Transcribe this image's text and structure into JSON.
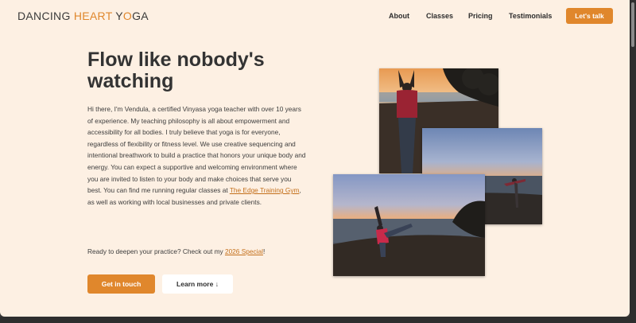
{
  "brand": {
    "part1": "DANCING ",
    "part2": "HEART",
    "part3": " Y",
    "part4": "O",
    "part5": "GA"
  },
  "nav": {
    "links": [
      "About",
      "Classes",
      "Pricing",
      "Testimonials"
    ],
    "cta_label": "Let's talk"
  },
  "hero": {
    "headline": "Flow like nobody's watching",
    "bio_before_link": "Hi there, I'm Vendula, a certified Vinyasa yoga teacher with over 10 years of experience. My teaching philosophy is all about empowerment and accessibility for all bodies. I truly believe that yoga is for everyone, regardless of flexibility or fitness level. We use creative sequencing and intentional breathwork to build a practice that honors your unique body and energy. You can expect a supportive and welcoming environment where you are invited to listen to your body and make choices that serve you best. You can find me running regular classes at ",
    "gym_link": "The Edge Training Gym",
    "bio_after_link": ", as well as working with local businesses and private clients.",
    "cta_before_link": "Ready to deepen your practice? Check out my ",
    "special_link": "2026 Special",
    "cta_after_link": "!",
    "primary_button": "Get in touch",
    "secondary_button": "Learn more ↓"
  },
  "photos": [
    "yoga-pose-arms-overhead-beach-photo",
    "yoga-pose-balance-sunset-photo",
    "yoga-pose-dancer-beach-photo"
  ],
  "colors": {
    "accent": "#e0872c",
    "background": "#fdf0e3",
    "text": "#333333"
  }
}
